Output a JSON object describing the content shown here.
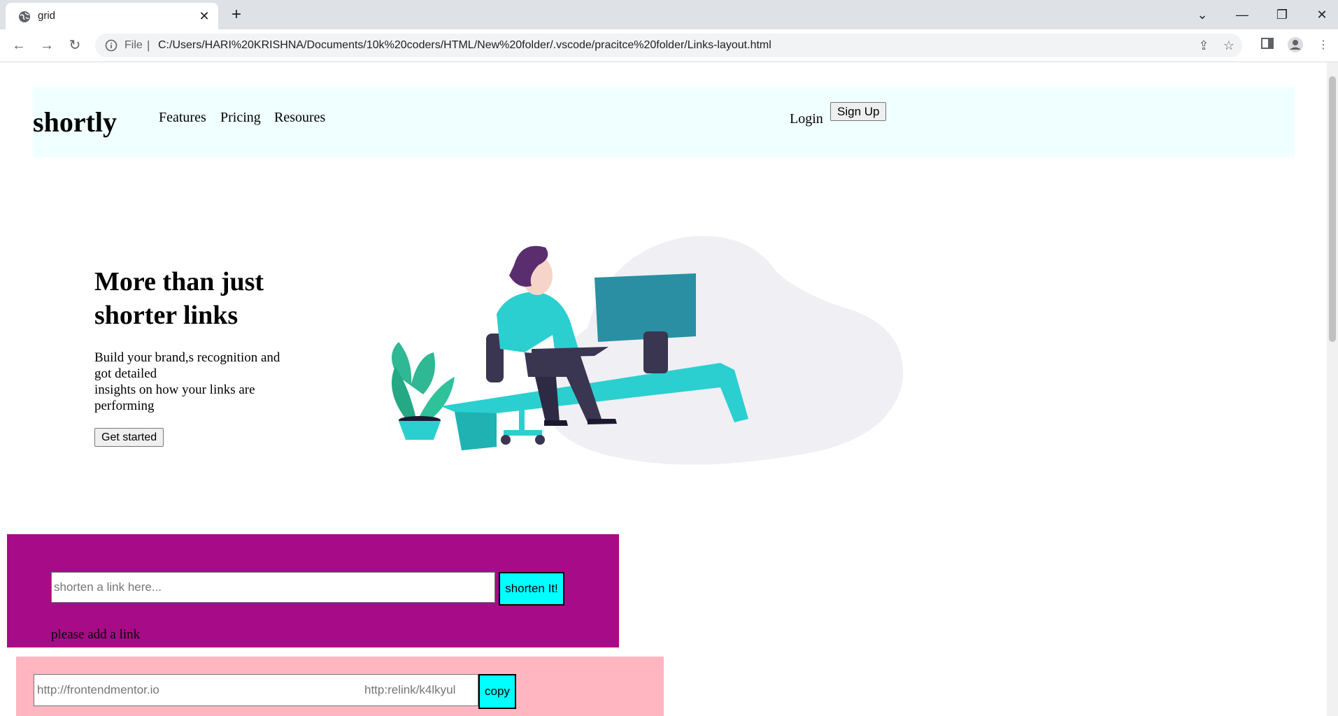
{
  "browser": {
    "tab_title": "grid",
    "new_tab": "+",
    "omnibox_file_label": "File",
    "omnibox_separator": "|",
    "url": "C:/Users/HARI%20KRISHNA/Documents/10k%20coders/HTML/New%20folder/.vscode/pracitce%20folder/Links-layout.html",
    "icons": [
      "globe-icon",
      "close-icon",
      "plus-icon",
      "back-icon",
      "forward-icon",
      "reload-icon",
      "info-icon",
      "share-icon",
      "star-icon",
      "side-panel-icon",
      "profile-icon",
      "more-icon",
      "minimize-icon",
      "restore-icon",
      "window-close-icon",
      "tab-search-icon"
    ]
  },
  "header": {
    "logo": "shortly",
    "nav": [
      "Features",
      "Pricing",
      "Resoures"
    ],
    "login": "Login",
    "signup": "Sign Up"
  },
  "hero": {
    "title": "More than just shorter links",
    "text_line1": "Build your brand,s recognition and got detailed",
    "text_line2": "insights on how your links are performing",
    "cta": "Get started"
  },
  "shorten": {
    "placeholder": "shorten a link here...",
    "button": "shorten It!",
    "message": "please add a link"
  },
  "result": {
    "original": "http://frontendmentor.io",
    "short": "http:relink/k4lkyul",
    "copy": "copy"
  },
  "colors": {
    "header_bg": "#f0ffff",
    "shorten_bg": "#a80b87",
    "result_bg": "#ffb6c1",
    "button_accent": "#00ffff"
  }
}
